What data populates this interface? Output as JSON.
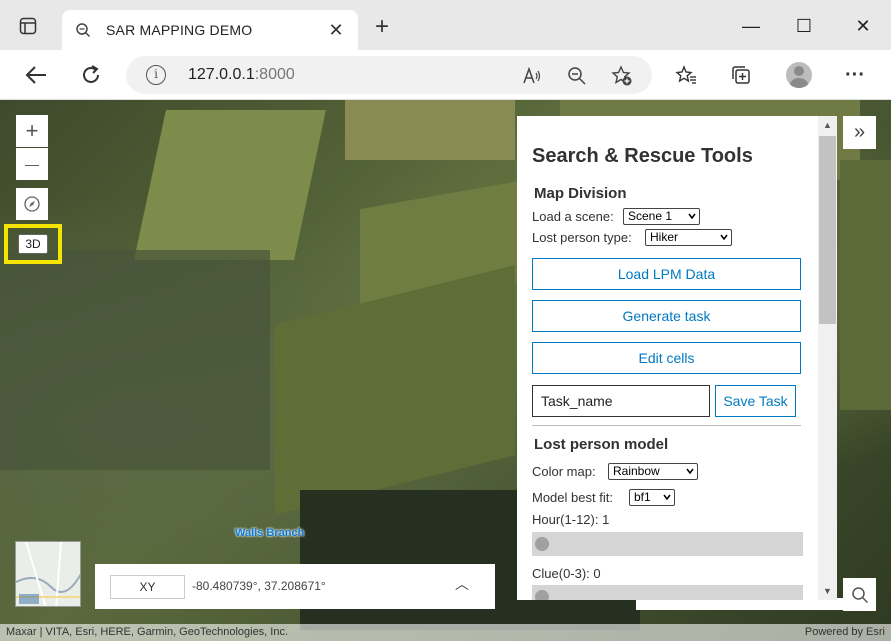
{
  "browser": {
    "tab_title": "SAR MAPPING DEMO",
    "tab_close": "✕",
    "new_tab": "+",
    "url_host": "127.0.0.1",
    "url_port": ":8000",
    "info_glyph": "i",
    "win_minimize": "—",
    "win_maximize": "☐",
    "win_close": "✕",
    "more_menu": "···"
  },
  "map": {
    "zoom_in": "+",
    "zoom_out": "—",
    "view_3d": "3D",
    "water_label": "Walls Branch",
    "coord_toggle": "XY",
    "coord_value": "-80.480739°, 37.208671°",
    "coord_chevron": "︿",
    "attribution": "Maxar | VITA, Esri, HERE, Garmin, GeoTechnologies, Inc.",
    "powered_by": "Powered by Esri",
    "expand_glyph": "»"
  },
  "panel": {
    "title": "Search & Rescue Tools",
    "map_division": {
      "heading": "Map Division",
      "scene_label": "Load a scene:",
      "scene_value": "Scene 1",
      "person_type_label": "Lost person type:",
      "person_type_value": "Hiker",
      "load_lpm_button": "Load LPM Data",
      "generate_task_button": "Generate task",
      "edit_cells_button": "Edit cells",
      "task_name_value": "Task_name",
      "save_task_button": "Save Task"
    },
    "lost_person_model": {
      "heading": "Lost person model",
      "color_map_label": "Color map:",
      "color_map_value": "Rainbow",
      "best_fit_label": "Model best fit:",
      "best_fit_value": "bf1",
      "hour_label": "Hour(1-12): 1",
      "hour_value": 1,
      "clue_label": "Clue(0-3): 0",
      "clue_value": 0
    }
  },
  "colors": {
    "accent": "#0079c1",
    "highlight": "#f5e400"
  }
}
